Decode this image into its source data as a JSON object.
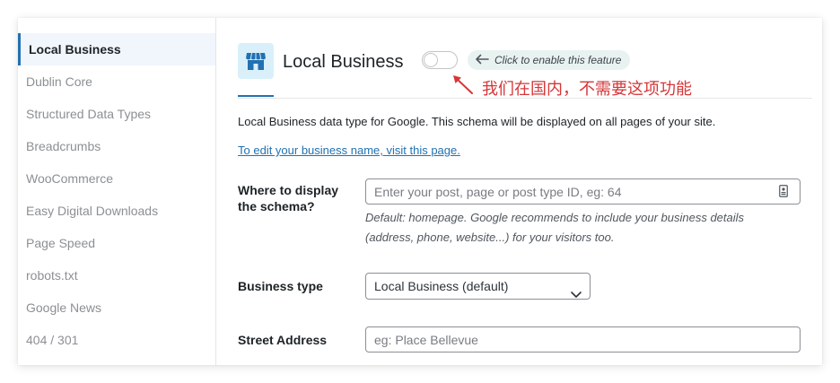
{
  "sidebar": {
    "items": [
      {
        "label": "Local Business"
      },
      {
        "label": "Dublin Core"
      },
      {
        "label": "Structured Data Types"
      },
      {
        "label": "Breadcrumbs"
      },
      {
        "label": "WooCommerce"
      },
      {
        "label": "Easy Digital Downloads"
      },
      {
        "label": "Page Speed"
      },
      {
        "label": "robots.txt"
      },
      {
        "label": "Google News"
      },
      {
        "label": "404 / 301"
      }
    ]
  },
  "header": {
    "title": "Local Business",
    "toggle_enabled": false,
    "hint": "Click to enable this feature",
    "annotation": "我们在国内，不需要这项功能"
  },
  "description": "Local Business data type for Google. This schema will be displayed on all pages of your site.",
  "edit_link": "To edit your business name, visit this page.",
  "fields": {
    "display": {
      "label_line1": "Where to display",
      "label_line2": "the schema?",
      "placeholder": "Enter your post, page or post type ID, eg: 64",
      "help_line1": "Default: homepage. Google recommends to include your business details",
      "help_line2": "(address, phone, website...) for your visitors too."
    },
    "business_type": {
      "label": "Business type",
      "selected": "Local Business (default)"
    },
    "street_address": {
      "label": "Street Address",
      "placeholder": "eg: Place Bellevue"
    }
  },
  "colors": {
    "accent": "#2271b1",
    "annotation": "#d63638",
    "icon_bg": "#d9f0fa"
  }
}
